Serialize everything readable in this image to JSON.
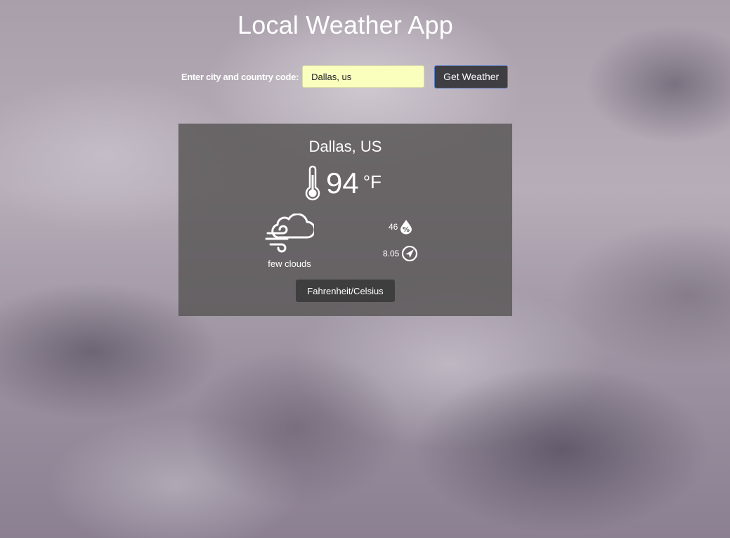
{
  "app": {
    "title": "Local Weather App"
  },
  "search": {
    "label": "Enter city and country code:",
    "value": "Dallas, us",
    "button_label": "Get Weather"
  },
  "weather": {
    "location": "Dallas, US",
    "temperature": "94",
    "unit": "°F",
    "condition": "few clouds",
    "condition_icon": "cloud-wind-icon",
    "humidity": "46",
    "humidity_icon": "humidity-percent-icon",
    "wind_speed": "8.05",
    "wind_icon": "wind-direction-compass-icon",
    "toggle_label": "Fahrenheit/Celsius"
  },
  "colors": {
    "input_background": "#fbffbe",
    "button_background": "#3f3f43",
    "card_background": "#585656"
  }
}
